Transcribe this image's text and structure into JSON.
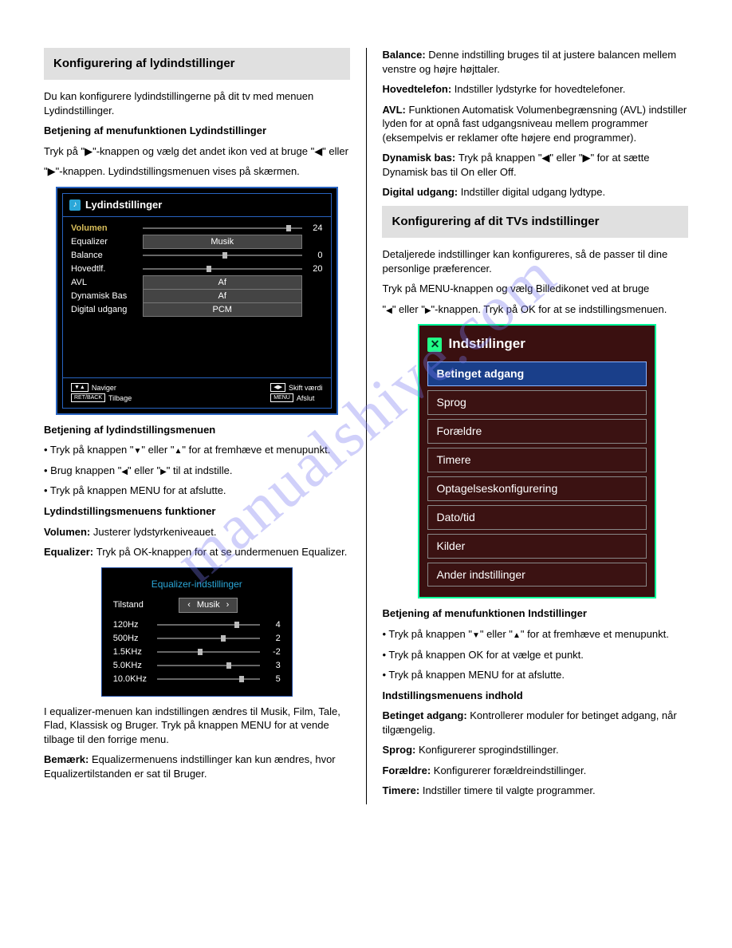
{
  "watermark": "manualshive.com",
  "left": {
    "sectionTitle": "Konfigurering af lydindstillinger",
    "intro": "Du kan konfigurere lydindstillingerne på dit tv med menuen Lydindstillinger.",
    "betjeningTitle": "Betjening af menufunktionen Lydindstillinger",
    "step1_a": "Tryk på ",
    "step1_b": "\"▶\"",
    "step1_c": "-knappen og vælg det andet ikon ved at bruge \"◀\" eller",
    "step2_a": "\"▶\"",
    "step2_b": "-knappen. Lydindstillingsmenuen vises på skærmen.",
    "panel": {
      "title": "Lydindstillinger",
      "rows": [
        {
          "label": "Volumen",
          "type": "slider",
          "val": "24",
          "pos": 90
        },
        {
          "label": "Equalizer",
          "type": "btn",
          "val": "Musik"
        },
        {
          "label": "Balance",
          "type": "slider",
          "val": "0",
          "pos": 50
        },
        {
          "label": "Hovedtlf.",
          "type": "slider",
          "val": "20",
          "pos": 40
        },
        {
          "label": "AVL",
          "type": "btn",
          "val": "Af"
        },
        {
          "label": "Dynamisk Bas",
          "type": "btn",
          "val": "Af"
        },
        {
          "label": "Digital udgang",
          "type": "btn",
          "val": "PCM"
        }
      ],
      "foot": {
        "nav": "Naviger",
        "back": "Tilbage",
        "shift": "Skift værdi",
        "menu": "Afslut",
        "retbackKey": "RET/BACK",
        "menuKey": "MENU"
      }
    },
    "opsTitle": "Betjening af lydindstillingsmenuen",
    "ops1_a": "• Tryk på knappen \"",
    "ops1_b": "▼",
    "ops1_c": "\" eller \"",
    "ops1_d": "▲",
    "ops1_e": "\" for at fremhæve et menupunkt.",
    "ops2_a": "• Brug knappen \"",
    "ops2_b": "◀",
    "ops2_c": "\" eller \"",
    "ops2_d": "▶",
    "ops2_e": "\" til at indstille.",
    "ops3": "• Tryk på knappen MENU for at afslutte.",
    "itemsTitle": "Lydindstillingsmenuens funktioner",
    "volLabel": "Volumen: ",
    "volText": "Justerer lydstyrkeniveauet.",
    "eqLabel": "Equalizer: ",
    "eqText1": "Tryk på OK-knappen for at se undermenuen Equalizer.",
    "eq": {
      "title": "Equalizer-indstillinger",
      "modeLabel": "Tilstand",
      "modeVal": "Musik",
      "bands": [
        {
          "hz": "120Hz",
          "val": "4",
          "pos": 75
        },
        {
          "hz": "500Hz",
          "val": "2",
          "pos": 62
        },
        {
          "hz": "1.5KHz",
          "val": "-2",
          "pos": 40
        },
        {
          "hz": "5.0KHz",
          "val": "3",
          "pos": 68
        },
        {
          "hz": "10.0KHz",
          "val": "5",
          "pos": 80
        }
      ]
    },
    "below1": "I equalizer-menuen kan indstillingen ændres til Musik, Film, Tale, Flad, Klassisk og Bruger. Tryk på knappen MENU for at vende tilbage til den forrige menu.",
    "below2_a": "Bemærk:",
    "below2_b": " Equalizermenuens indstillinger kan kun ændres, hvor Equalizertilstanden er sat til Bruger."
  },
  "right": {
    "balLabel": "Balance: ",
    "balText": "Denne indstilling bruges til at justere balancen mellem venstre og højre højttaler.",
    "hpLabel": "Hovedtelefon: ",
    "hpText": "Indstiller lydstyrke for hovedtelefoner.",
    "avlLabel": "AVL: ",
    "avlText": "Funktionen Automatisk Volumenbegrænsning (AVL) indstiller lyden for at opnå fast udgangsniveau mellem programmer (eksempelvis er reklamer ofte højere end programmer).",
    "dynLabel": "Dynamisk bas: ",
    "dynText": "Tryk på knappen \"◀\" eller \"▶\" for at sætte Dynamisk bas til On eller Off.",
    "digLabel": "Digital udgang: ",
    "digText": "Indstiller digital udgang lydtype.",
    "sectionTitle": "Konfigurering af dit TVs indstillinger",
    "intro": "Detaljerede indstillinger kan konfigureres, så de passer til dine personlige præferencer.",
    "step1": "Tryk på MENU-knappen og vælg Billedikonet ved at bruge",
    "step2_a": "\"",
    "step2_b": "◀",
    "step2_c": "\" eller \"",
    "step2_d": "▶",
    "step2_e": "\"-knappen. Tryk på OK for at se indstillingsmenuen.",
    "settings": {
      "title": "Indstillinger",
      "items": [
        "Betinget adgang",
        "Sprog",
        "Forældre",
        "Timere",
        "Optagelseskonfigurering",
        "Dato/tid",
        "Kilder",
        "Ander indstillinger"
      ]
    },
    "opsTitle": "Betjening af menufunktionen Indstillinger",
    "ops1_a": "• Tryk på knappen \"",
    "ops1_b": "▼",
    "ops1_c": "\" eller \"",
    "ops1_d": "▲",
    "ops1_e": "\" for at fremhæve et menupunkt.",
    "ops2": "• Tryk på knappen OK for at vælge et punkt.",
    "ops3": "• Tryk på knappen MENU for at afslutte.",
    "itemsTitle": "Indstillingsmenuens indhold",
    "caLabel": "Betinget adgang: ",
    "caText": "Kontrollerer moduler for betinget adgang, når tilgængelig.",
    "langLabel": "Sprog: ",
    "langText": "Konfigurerer sprogindstillinger.",
    "parLabel": "Forældre: ",
    "parText": "Konfigurerer forældreindstillinger.",
    "timLabel": "Timere: ",
    "timText": "Indstiller timere til valgte programmer."
  }
}
